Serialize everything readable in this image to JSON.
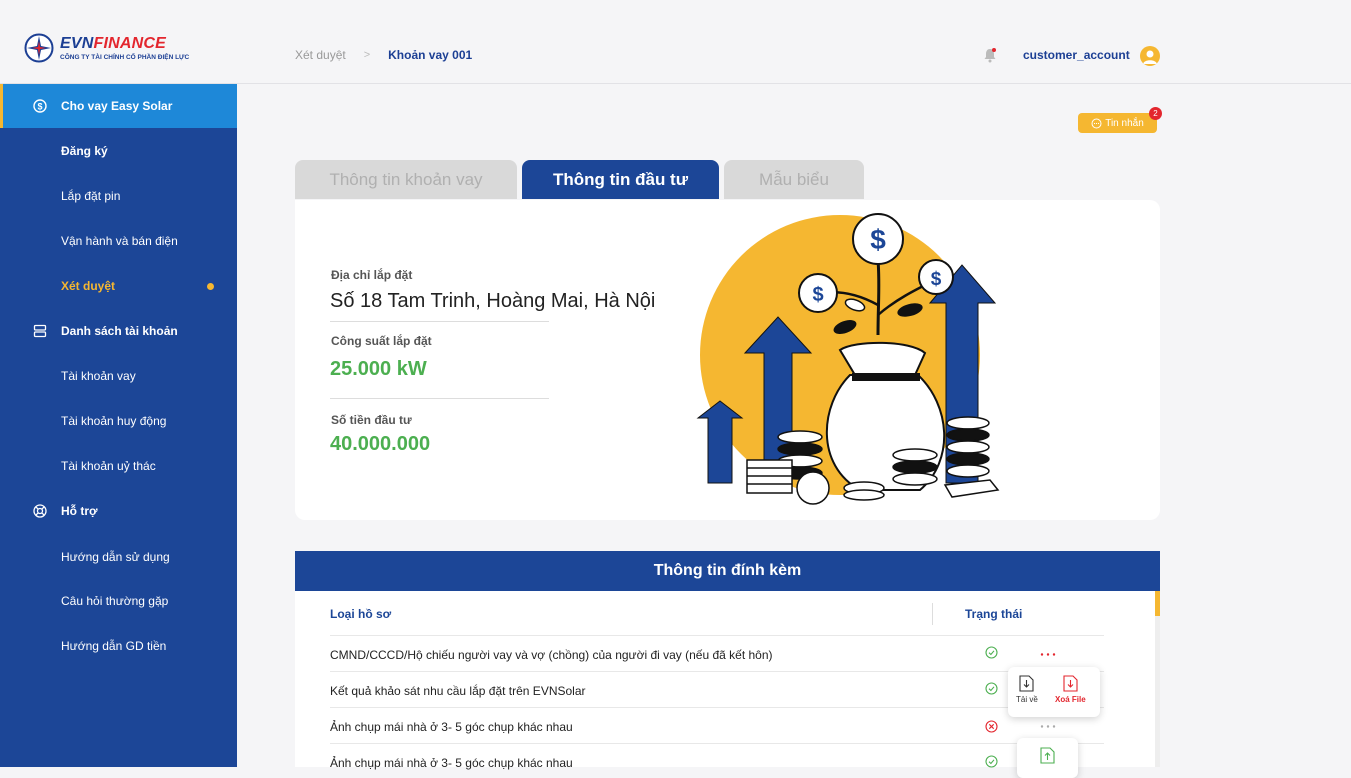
{
  "logo": {
    "brand_a": "EVN",
    "brand_b": "FINANCE",
    "subtitle": "CÔNG TY TÀI CHÍNH CỔ PHẦN ĐIỆN LỰC"
  },
  "breadcrumb": {
    "parent": "Xét duyệt",
    "separator": ">",
    "current": "Khoản vay 001"
  },
  "user": {
    "name": "customer_account"
  },
  "sidebar": {
    "items": [
      {
        "label": "Cho vay Easy Solar"
      },
      {
        "label": "Đăng ký"
      },
      {
        "label": "Lắp đặt pin"
      },
      {
        "label": "Vận hành và bán điện"
      },
      {
        "label": "Xét duyệt"
      },
      {
        "label": "Danh sách tài khoản"
      },
      {
        "label": "Tài khoản vay"
      },
      {
        "label": "Tài khoản huy động"
      },
      {
        "label": "Tài khoản uỷ thác"
      },
      {
        "label": "Hỗ trợ"
      },
      {
        "label": "Hướng dẫn sử dụng"
      },
      {
        "label": "Câu hỏi thường gặp"
      },
      {
        "label": "Hướng dẫn GD tiền"
      }
    ]
  },
  "messages": {
    "label": "Tin nhắn",
    "count": "2"
  },
  "tabs": [
    {
      "label": "Thông tin khoản vay",
      "active": false
    },
    {
      "label": "Thông tin đầu tư",
      "active": true
    },
    {
      "label": "Mẫu biểu",
      "active": false
    }
  ],
  "investment": {
    "address_label": "Địa chỉ lắp đặt",
    "address_value": "Số 18 Tam Trinh, Hoàng Mai, Hà Nội",
    "capacity_label": "Công suất lắp đặt",
    "capacity_value": "25.000 kW",
    "amount_label": "Số tiền đầu tư",
    "amount_value": "40.000.000"
  },
  "attachments": {
    "title": "Thông tin đính kèm",
    "col_type": "Loại hồ sơ",
    "col_status": "Trạng thái",
    "rows": [
      {
        "name": "CMND/CCCD/Hộ chiếu người vay và vợ (chồng) của người đi vay (nếu đã kết hôn)",
        "status": "ok"
      },
      {
        "name": "Kết quả khảo sát nhu cầu lắp đặt trên EVNSolar",
        "status": "ok"
      },
      {
        "name": "Ảnh chụp mái nhà ở 3- 5 góc chụp khác nhau",
        "status": "error"
      },
      {
        "name": "Ảnh chụp mái nhà ở 3- 5 góc chụp khác nhau",
        "status": "ok"
      }
    ],
    "popup": {
      "download_label": "Tải về",
      "delete_label": "Xoá File"
    }
  },
  "colors": {
    "primary": "#1c4697",
    "accent": "#f5b731",
    "active_item": "#1e88d8",
    "success": "#4caf50",
    "danger": "#e3262e"
  }
}
